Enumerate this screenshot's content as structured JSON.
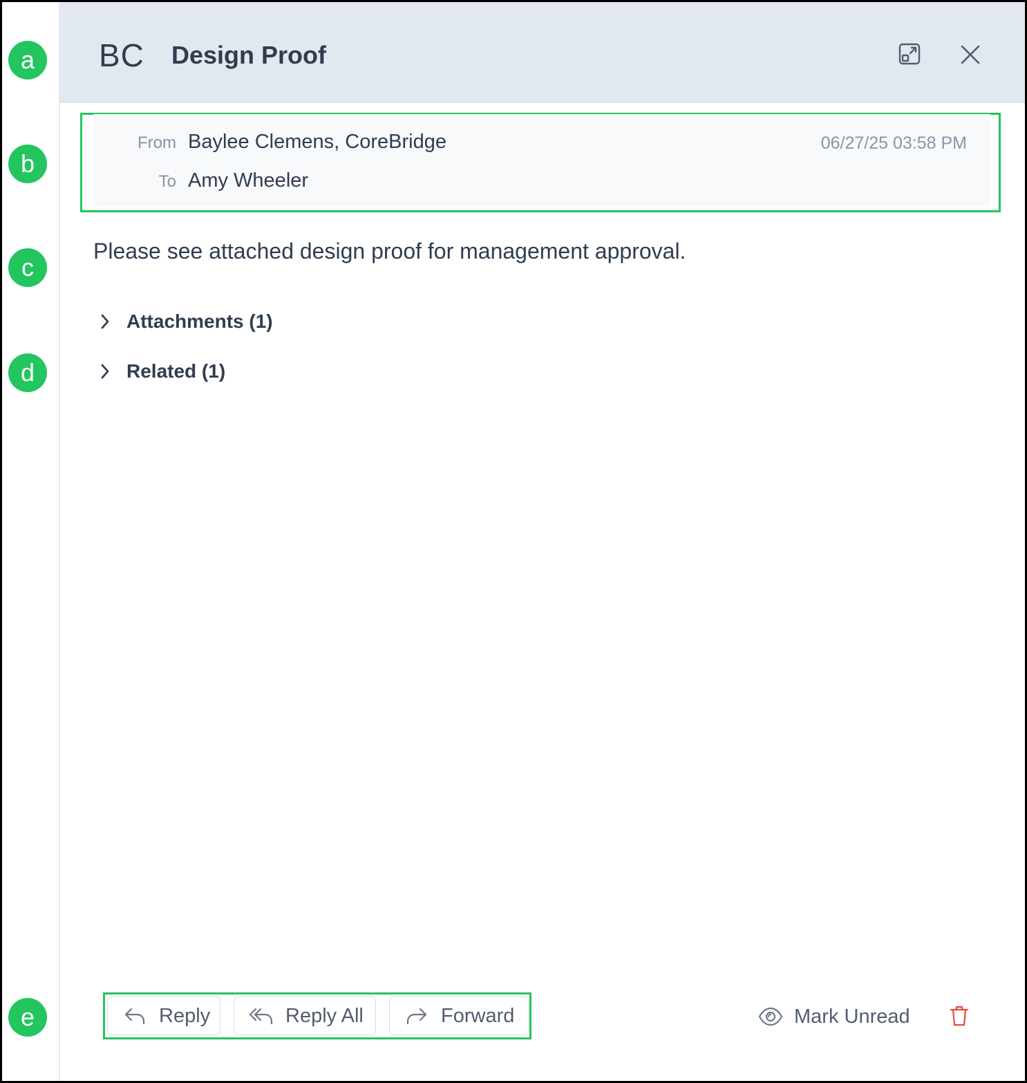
{
  "callouts": [
    "a",
    "b",
    "c",
    "d",
    "e"
  ],
  "header": {
    "initials": "BC",
    "title": "Design Proof",
    "popout_icon": "popout-icon",
    "close_icon": "close-icon"
  },
  "message": {
    "from_label": "From",
    "from_value": "Baylee Clemens, CoreBridge",
    "to_label": "To",
    "to_value": "Amy Wheeler",
    "date": "06/27/25 03:58 PM",
    "body": "Please see attached design proof for management approval."
  },
  "sections": {
    "attachments": "Attachments (1)",
    "related": "Related (1)"
  },
  "actions": {
    "reply": "Reply",
    "reply_all": "Reply All",
    "forward": "Forward",
    "mark_unread": "Mark Unread",
    "delete_icon": "trash-icon"
  },
  "colors": {
    "callout": "#22c55e",
    "header_bg": "#e2e8f0",
    "delete": "#e5483d"
  }
}
